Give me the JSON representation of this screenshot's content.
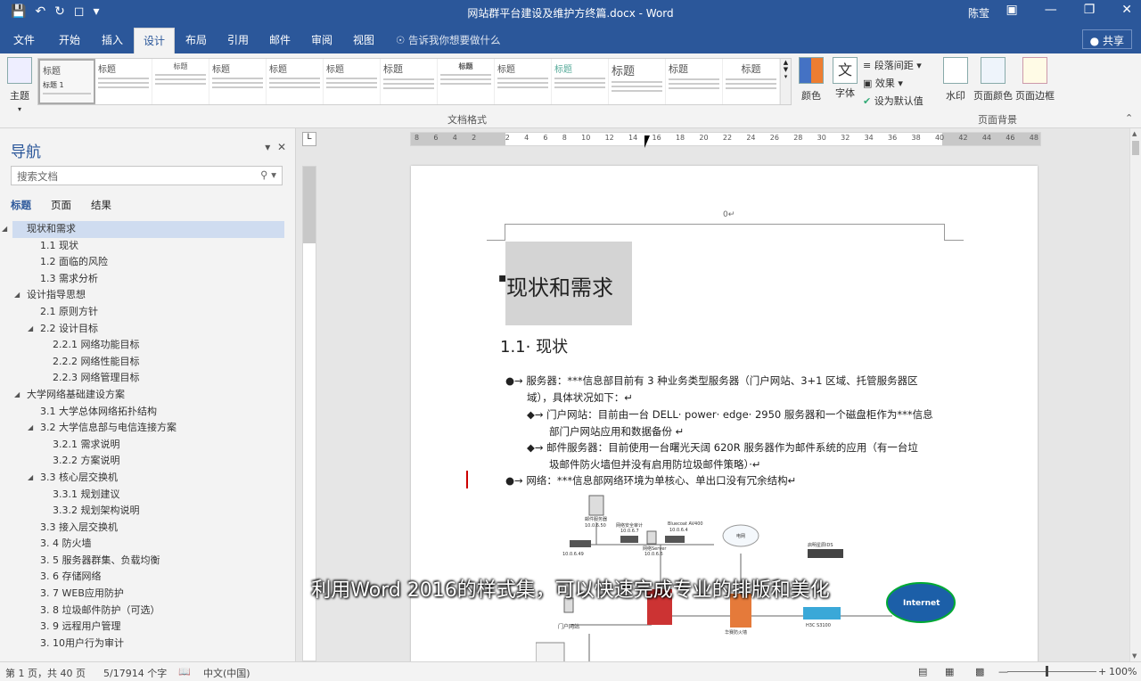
{
  "window": {
    "title": "网站群平台建设及维护方终篇.docx - Word",
    "user": "陈莹",
    "share": "共享"
  },
  "tabs": [
    "文件",
    "开始",
    "插入",
    "设计",
    "布局",
    "引用",
    "邮件",
    "审阅",
    "视图"
  ],
  "tellme": "告诉我你想要做什么",
  "ribbon": {
    "theme": "主题",
    "doc_format_label": "文档格式",
    "gallery_sample": "标题",
    "gallery_sample_first": "标题 1",
    "colors": "颜色",
    "fonts": "字体",
    "para_spacing": "段落间距",
    "effects": "效果",
    "set_default": "设为默认值",
    "watermark": "水印",
    "page_color": "页面颜色",
    "page_border": "页面边框",
    "page_bg_label": "页面背景"
  },
  "nav": {
    "title": "导航",
    "search_placeholder": "搜索文档",
    "tabs": [
      "标题",
      "页面",
      "结果"
    ],
    "items": [
      {
        "label": "现状和需求",
        "level": 1
      },
      {
        "label": "1.1 现状",
        "level": 2
      },
      {
        "label": "1.2 面临的风险",
        "level": 2
      },
      {
        "label": "1.3 需求分析",
        "level": 2
      },
      {
        "label": "设计指导思想",
        "level": 1
      },
      {
        "label": "2.1 原则方针",
        "level": 2
      },
      {
        "label": "2.2 设计目标",
        "level": 2
      },
      {
        "label": "2.2.1 网络功能目标",
        "level": 3
      },
      {
        "label": "2.2.2 网络性能目标",
        "level": 3
      },
      {
        "label": "2.2.3 网络管理目标",
        "level": 3
      },
      {
        "label": "大学网络基础建设方案",
        "level": 1
      },
      {
        "label": "3.1 大学总体网络拓扑结构",
        "level": 2
      },
      {
        "label": "3.2 大学信息部与电信连接方案",
        "level": 2
      },
      {
        "label": "3.2.1 需求说明",
        "level": 3
      },
      {
        "label": "3.2.2 方案说明",
        "level": 3
      },
      {
        "label": "3.3 核心层交换机",
        "level": 2
      },
      {
        "label": "3.3.1 规划建议",
        "level": 3
      },
      {
        "label": "3.3.2 规划架构说明",
        "level": 3
      },
      {
        "label": "3.3 接入层交换机",
        "level": 2
      },
      {
        "label": "3. 4 防火墙",
        "level": 2
      },
      {
        "label": "3. 5 服务器群集、负载均衡",
        "level": 2
      },
      {
        "label": "3. 6 存储网络",
        "level": 2
      },
      {
        "label": "3. 7 WEB应用防护",
        "level": 2
      },
      {
        "label": "3. 8 垃圾邮件防护（可选）",
        "level": 2
      },
      {
        "label": "3. 9 远程用户管理",
        "level": 2
      },
      {
        "label": "3. 10用户行为审计",
        "level": 2
      }
    ]
  },
  "ruler": {
    "h_numbers": [
      "8",
      "6",
      "4",
      "2",
      "",
      "2",
      "4",
      "6",
      "8",
      "10",
      "12",
      "14",
      "16",
      "18",
      "20",
      "22",
      "24",
      "26",
      "28",
      "30",
      "32",
      "34",
      "36",
      "38",
      "40",
      "42",
      "44",
      "46",
      "48"
    ]
  },
  "doc": {
    "header_num": "0↵",
    "h1": "现状和需求",
    "h2": "1.1· 现状",
    "p1": "●→ 服务器：***信息部目前有 3 种业务类型服务器（门户网站、3+1 区域、托管服务器区",
    "p1b": "域），具体状况如下：↵",
    "p2": "◆→ 门户网站：目前由一台 DELL· power· edge· 2950 服务器和一个磁盘柜作为***信息",
    "p2b": "部门户网站应用和数据备份 ↵",
    "p3": "◆→ 邮件服务器：目前使用一台曙光天阔 620R 服务器作为邮件系统的应用（有一台垃",
    "p3b": "圾邮件防火墙但并没有启用防垃圾邮件策略）·↵",
    "p4": "●→ 网络：***信息部网络环境为单核心、单出口没有冗余结构↵",
    "diagram_labels": {
      "mail_server": "邮件服务器",
      "mail_ip": "10.0.6.50",
      "ip1": "10.0.6.49",
      "ip2": "10.0.6.7",
      "ip3": "10.0.6.4",
      "bluecoat": "Bluecoat AV400",
      "net_server": "网络Server",
      "net_ip": "10.0.6.6",
      "internet": "Internet",
      "portal": "门户网站",
      "h3c": "H3C S3100",
      "ids": "启明星辰IDS",
      "cloud": "电网",
      "fw": "华赛防火墙",
      "audit": "网络安全审计"
    }
  },
  "subtitle": "利用Word 2016的样式集，可以快速完成专业的排版和美化",
  "status": {
    "page": "第 1 页，共 40 页",
    "words": "5/17914 个字",
    "lang": "中文(中国)",
    "zoom": "100%"
  }
}
